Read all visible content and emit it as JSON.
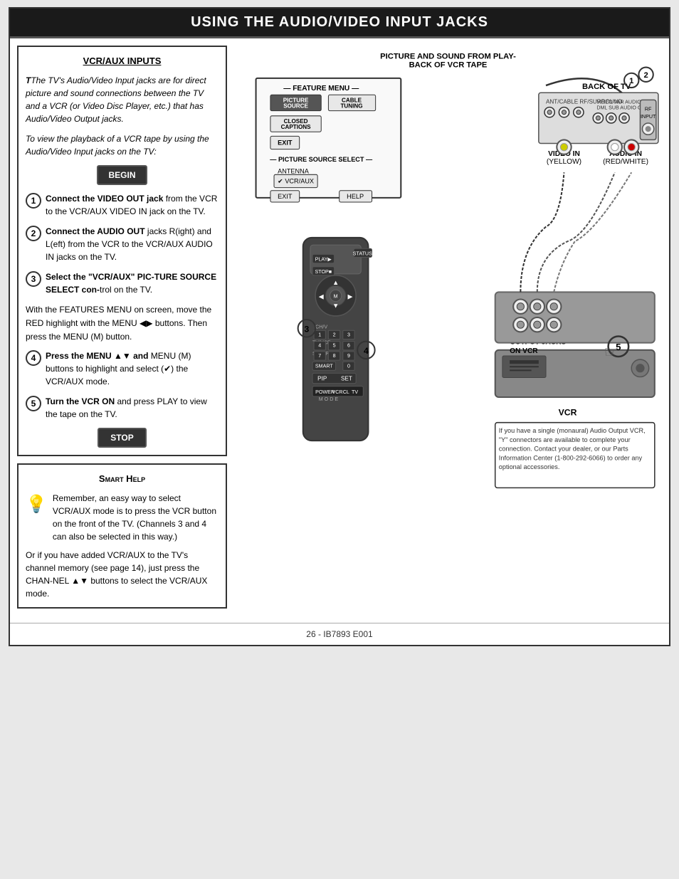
{
  "header": {
    "title": "Using the Audio/Video Input Jacks"
  },
  "left": {
    "vcr_aux_title": "VCR/AUX INPUTS",
    "intro_text": "The TV's Audio/Video Input jacks are for direct picture and sound connections between the TV and a VCR (or Video Disc Player, etc.) that has Audio/Video Output jacks.",
    "view_text": "To view the playback of a VCR tape by using the Audio/Video Input jacks on the TV:",
    "begin_label": "BEGIN",
    "steps": [
      {
        "num": "1",
        "bold": "Connect the VIDEO OUT jack",
        "text": " from the VCR to the VCR/AUX VIDEO IN jack on the TV."
      },
      {
        "num": "2",
        "bold": "Connect the AUDIO OUT",
        "text": " jacks R(ight) and L(eft) from the VCR to the VCR/AUX AUDIO IN jacks on the TV."
      },
      {
        "num": "3",
        "bold": "Select the \"VCR/AUX\" PIC-TURE SOURCE SELECT con-",
        "text": "trol on the TV."
      }
    ],
    "middle_text": "With the FEATURES MENU on screen, move the RED highlight with the MENU ◀▶ buttons. Then press the MENU (M) button.",
    "step4": {
      "num": "4",
      "bold": "Press the MENU ▲▼ and",
      "text": "MENU (M) buttons to highlight and select (✔) the VCR/AUX mode."
    },
    "step5": {
      "num": "5",
      "bold": "Turn the VCR ON",
      "text": " and press PLAY to view the tape on the TV."
    },
    "stop_label": "STOP"
  },
  "smart_help": {
    "title": "Smart Help",
    "text1": "Remember, an easy way to select VCR/AUX mode is to press the VCR button on the front of the TV. (Channels 3 and 4 can also be selected in this way.)",
    "text2": "Or if you have added VCR/AUX to the TV's channel memory (see page 14), just press the CHAN-NEL ▲▼ buttons to select the VCR/AUX mode."
  },
  "diagram": {
    "title_top": "PICTURE AND SOUND FROM PLAY-BACK OF VCR TAPE",
    "back_of_tv": "BACK OF TV",
    "video_in": "VIDEO IN",
    "video_in_color": "(YELLOW)",
    "audio_in": "AUDIO IN",
    "audio_in_color": "(RED/WHITE)",
    "audio_video_output": "AUDIO/VIDEO OUTPUT JACKS ON VCR",
    "vcr_label": "VCR",
    "note_text": "If you have a single (monaural) Audio Output VCR, \"Y\" connectors are available to complete your connection. Contact your dealer, or our Parts Information Center (1-800-292-6066) to order any optional accessories.",
    "feature_menu": "FEATURE MENU",
    "antenna_label": "ANTENNA",
    "vcr_aux_label": "✔ VCR/AUX",
    "picture_source": "PICTURE SOURCE SELECT",
    "cable_tuning": "CABLE TUNING",
    "picture_source_btn": "PICTURE SOURCE",
    "closed_captions": "CLOSED CAPTIONS",
    "exit_btn": "EXIT",
    "pip_label": "PIP",
    "set_label": "SET",
    "step_labels": [
      "3",
      "4",
      "5"
    ],
    "step_marker1": "3",
    "step_marker2": "4"
  },
  "footer": {
    "text": "26 - IB7893 E001"
  }
}
